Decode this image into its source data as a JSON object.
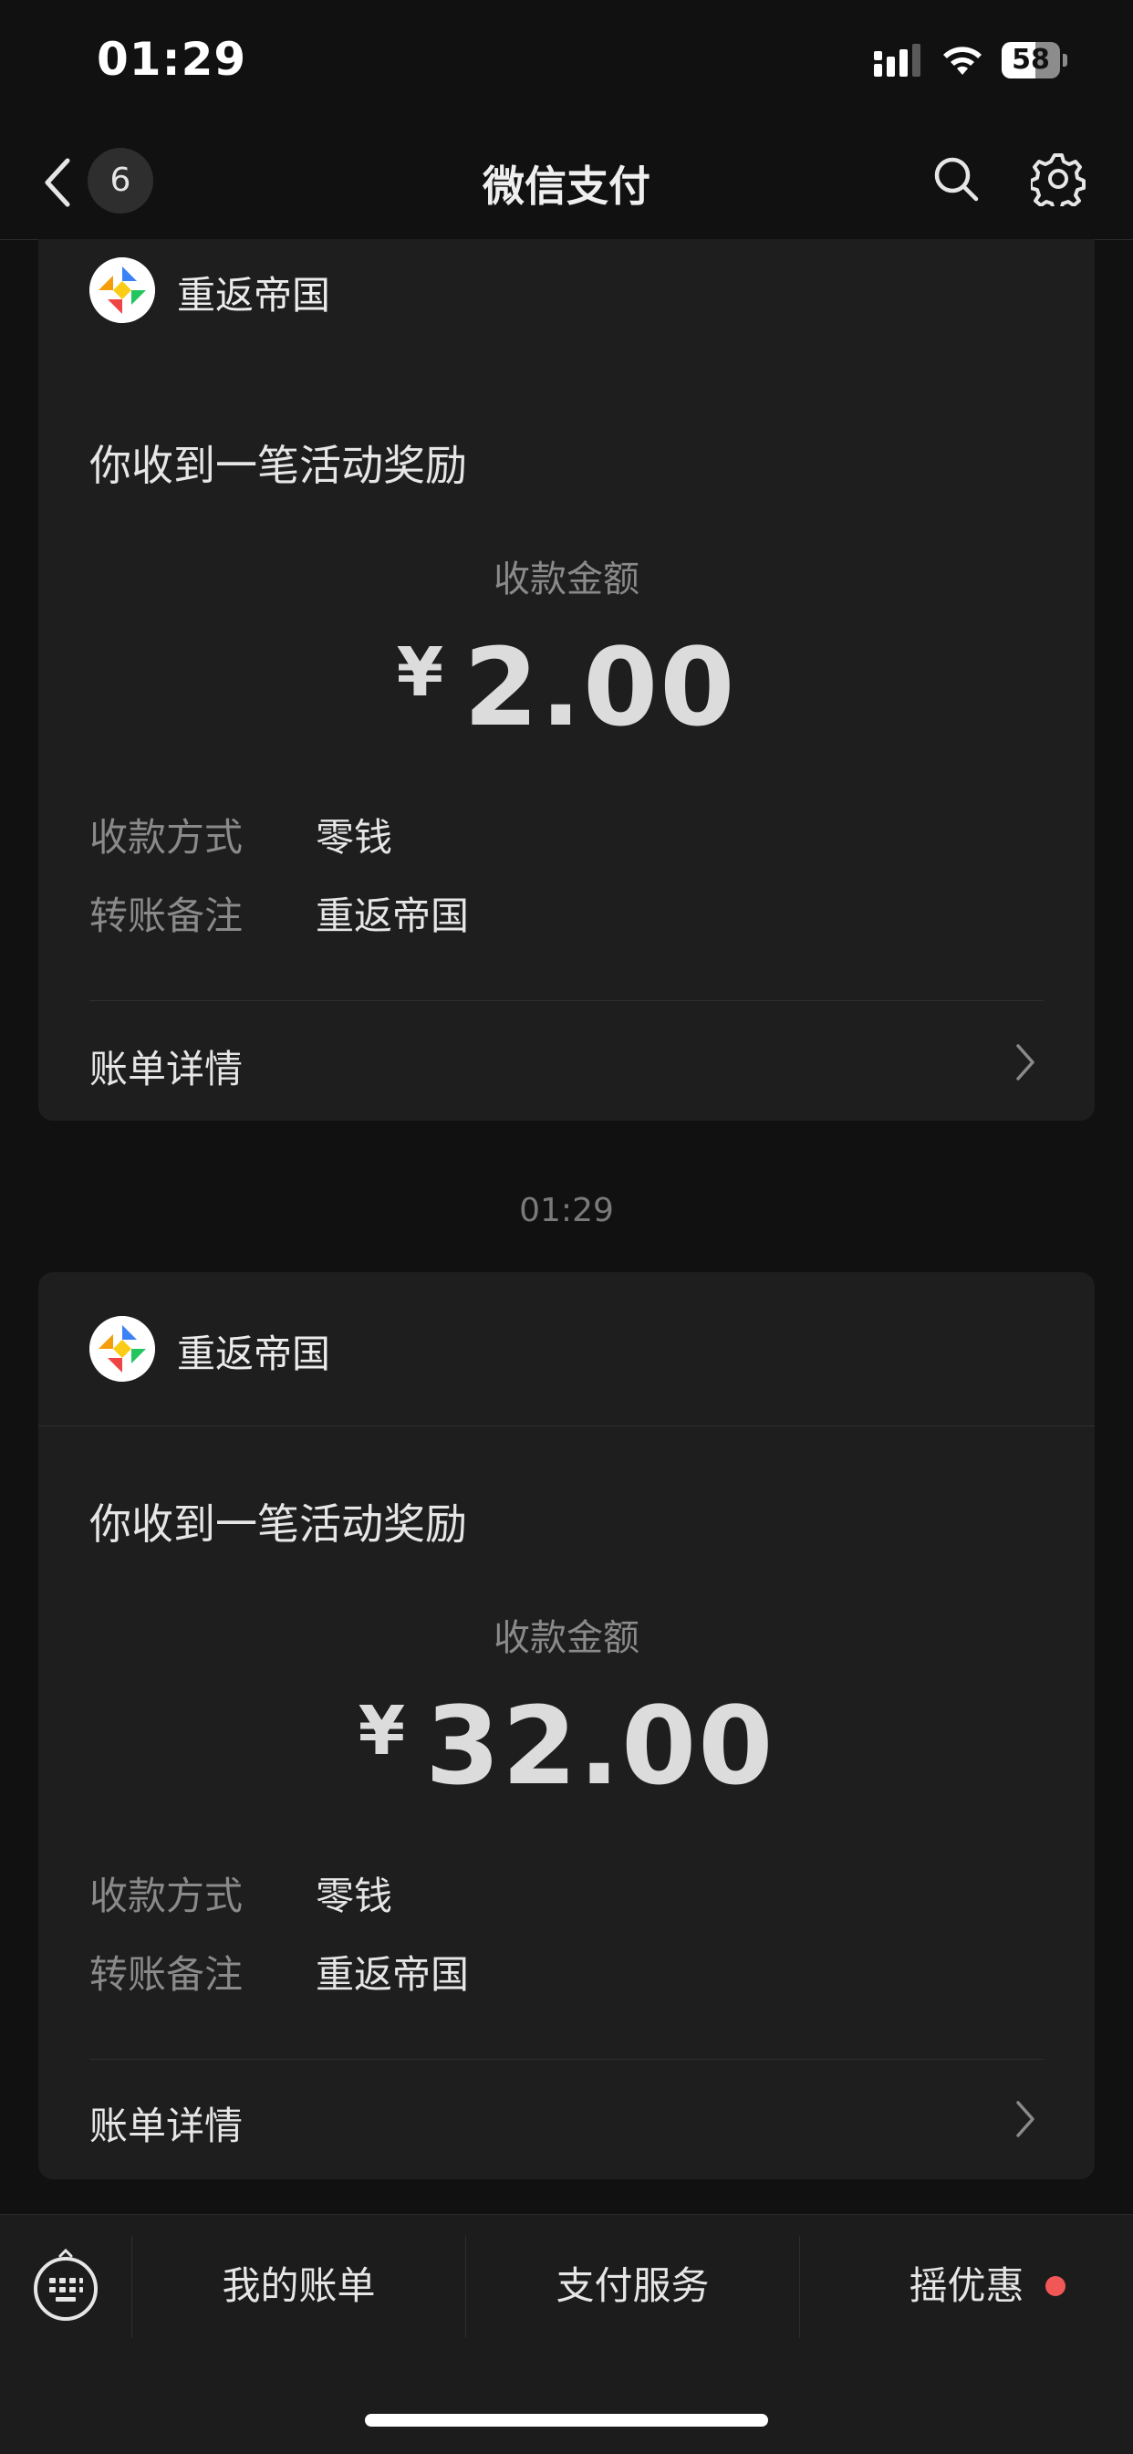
{
  "status_bar": {
    "time": "01:29",
    "battery": "58",
    "battery_level": 0.58
  },
  "nav": {
    "unread_count": "6",
    "title": "微信支付"
  },
  "cards": [
    {
      "merchant": "重返帝国",
      "title": "你收到一笔活动奖励",
      "amount_label": "收款金额",
      "currency": "¥",
      "amount": "2.00",
      "method_label": "收款方式",
      "method_value": "零钱",
      "note_label": "转账备注",
      "note_value": "重返帝国",
      "detail_label": "账单详情"
    },
    {
      "merchant": "重返帝国",
      "title": "你收到一笔活动奖励",
      "amount_label": "收款金额",
      "currency": "¥",
      "amount": "32.00",
      "method_label": "收款方式",
      "method_value": "零钱",
      "note_label": "转账备注",
      "note_value": "重返帝国",
      "detail_label": "账单详情"
    }
  ],
  "timestamp": "01:29",
  "bottom_bar": {
    "tabs": [
      {
        "label": "我的账单"
      },
      {
        "label": "支付服务"
      },
      {
        "label": "摇优惠"
      }
    ],
    "badge_color": "#f25757"
  }
}
